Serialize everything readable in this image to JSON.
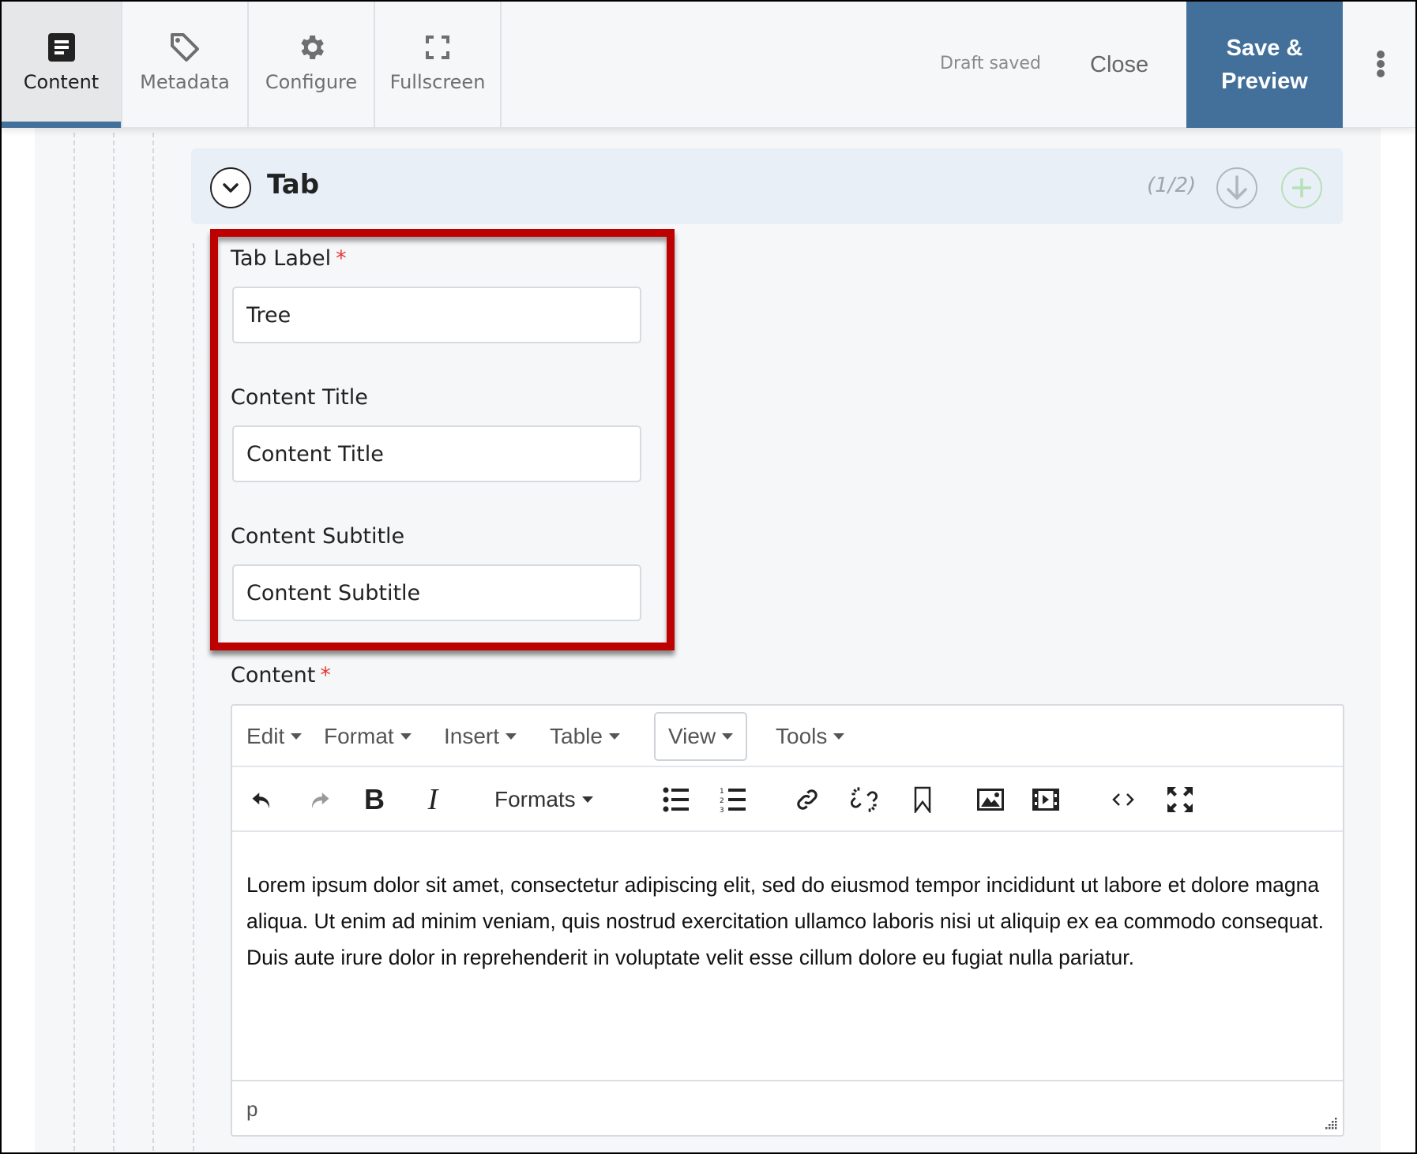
{
  "nav": {
    "tabs": [
      {
        "label": "Content",
        "icon": "document-icon",
        "active": true
      },
      {
        "label": "Metadata",
        "icon": "tag-icon",
        "active": false
      },
      {
        "label": "Configure",
        "icon": "gear-icon",
        "active": false
      },
      {
        "label": "Fullscreen",
        "icon": "fullscreen-icon",
        "active": false
      }
    ],
    "status": "Draft saved",
    "close_label": "Close",
    "save_label_line1": "Save &",
    "save_label_line2": "Preview",
    "more_icon": "kebab-menu-icon"
  },
  "colors": {
    "accent": "#43709b",
    "highlight": "#bd0000",
    "required": "#e53935",
    "tab_header_bg": "#e8eff7",
    "add_button": "#b6e0b6"
  },
  "tab_section": {
    "title": "Tab",
    "counter": "(1/2)",
    "collapse_icon": "chevron-down-circle-icon",
    "move_down_icon": "arrow-down-circle-icon",
    "add_icon": "plus-circle-icon"
  },
  "fields": {
    "tab_label": {
      "label": "Tab Label",
      "required_mark": "*",
      "value": "Tree"
    },
    "content_title": {
      "label": "Content Title",
      "value": "Content Title"
    },
    "content_subtitle": {
      "label": "Content Subtitle",
      "value": "Content Subtitle"
    },
    "content": {
      "label": "Content",
      "required_mark": "*"
    }
  },
  "editor": {
    "menus": [
      "Edit",
      "Format",
      "Insert",
      "Table",
      "View",
      "Tools"
    ],
    "formats_label": "Formats",
    "toolbar_icons": [
      "undo-icon",
      "redo-icon",
      "bold-icon",
      "italic-icon",
      "formats-dropdown",
      "bullet-list-icon",
      "numbered-list-icon",
      "link-icon",
      "unlink-icon",
      "bookmark-icon",
      "image-icon",
      "video-icon",
      "source-code-icon",
      "fullscreen-icon"
    ],
    "body_text": "Lorem ipsum dolor sit amet, consectetur adipiscing elit, sed do eiusmod tempor incididunt ut labore et dolore magna aliqua. Ut enim ad minim veniam, quis nostrud exercitation ullamco laboris nisi ut aliquip ex ea commodo consequat. Duis aute irure dolor in reprehenderit in voluptate velit esse cillum dolore eu fugiat nulla pariatur.",
    "status_path": "p"
  }
}
